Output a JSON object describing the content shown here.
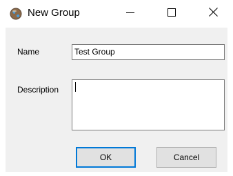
{
  "window": {
    "title": "New Group"
  },
  "form": {
    "name_label": "Name",
    "name_value": "Test Group",
    "description_label": "Description",
    "description_value": ""
  },
  "buttons": {
    "ok_label": "OK",
    "cancel_label": "Cancel"
  },
  "icons": {
    "app": "globe-icon",
    "minimize": "minimize-icon",
    "maximize": "maximize-icon",
    "close": "close-icon"
  },
  "colors": {
    "focus_border": "#0078d7",
    "client_bg": "#f0f0f0",
    "button_bg": "#e1e1e1"
  }
}
